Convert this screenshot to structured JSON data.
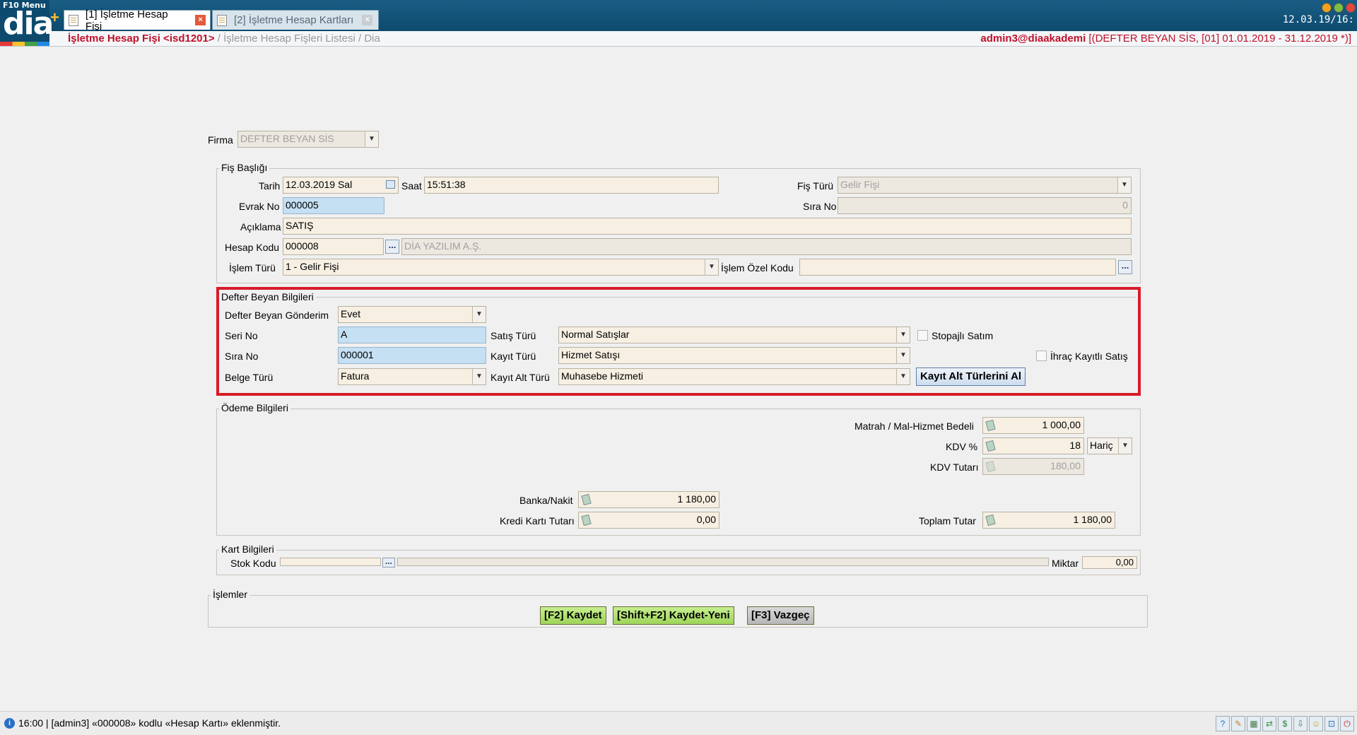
{
  "app": {
    "menu_label": "F10 Menu",
    "logo_text": "dia",
    "add_symbol": "+",
    "clock": "12.03.19/16:"
  },
  "tabs": [
    {
      "label": "[1] İşletme Hesap Fişi",
      "close": "×"
    },
    {
      "label": "[2] İşletme Hesap Kartları",
      "close": "×"
    }
  ],
  "breadcrumb": {
    "current": "İşletme Hesap Fişi <isd1201>",
    "trail": " / İşletme Hesap Fişleri Listesi / Dia"
  },
  "user": {
    "name": "admin3@diaakademi",
    "context": " [(DEFTER BEYAN SİS, [01] 01.01.2019 - 31.12.2019 *)]"
  },
  "firma": {
    "label": "Firma",
    "value": "DEFTER BEYAN SİS"
  },
  "fis_basligi": {
    "title": "Fiş Başlığı",
    "tarih_label": "Tarih",
    "tarih": "12.03.2019 Sal",
    "saat_label": "Saat",
    "saat": "15:51:38",
    "fis_turu_label": "Fiş Türü",
    "fis_turu": "Gelir Fişi",
    "evrak_no_label": "Evrak No",
    "evrak_no": "000005",
    "sira_no_label": "Sıra No",
    "sira_no": "0",
    "aciklama_label": "Açıklama",
    "aciklama": "SATIŞ",
    "hesap_kodu_label": "Hesap Kodu",
    "hesap_kodu": "000008",
    "hesap_adi": "DİA YAZILIM A.Ş.",
    "islem_turu_label": "İşlem Türü",
    "islem_turu": "1 - Gelir Fişi",
    "islem_ozel_kodu_label": "İşlem Özel Kodu",
    "islem_ozel_kodu": "",
    "lookup_btn": "..."
  },
  "defter_beyan": {
    "title": "Defter Beyan Bilgileri",
    "gonderim_label": "Defter Beyan Gönderim",
    "gonderim": "Evet",
    "seri_no_label": "Seri No",
    "seri_no": "A",
    "sira_no_label": "Sıra No",
    "sira_no": "000001",
    "belge_turu_label": "Belge Türü",
    "belge_turu": "Fatura",
    "satis_turu_label": "Satış Türü",
    "satis_turu": "Normal Satışlar",
    "kayit_turu_label": "Kayıt Türü",
    "kayit_turu": "Hizmet Satışı",
    "kayit_alt_turu_label": "Kayıt Alt Türü",
    "kayit_alt_turu": "Muhasebe Hizmeti",
    "stopajli_label": "Stopajlı Satım",
    "stopajli": false,
    "ihrac_label": "İhraç Kayıtlı Satış",
    "ihrac": false,
    "alt_turler_button": "Kayıt Alt Türlerini Al"
  },
  "odeme": {
    "title": "Ödeme Bilgileri",
    "matrah_label": "Matrah / Mal-Hizmet Bedeli",
    "matrah": "1 000,00",
    "kdv_label": "KDV %",
    "kdv": "18",
    "kdv_tip": "Hariç",
    "kdv_tutar_label": "KDV Tutarı",
    "kdv_tutar": "180,00",
    "banka_label": "Banka/Nakit",
    "banka": "1 180,00",
    "kredi_label": "Kredi Kartı Tutarı",
    "kredi": "0,00",
    "toplam_label": "Toplam Tutar",
    "toplam": "1 180,00"
  },
  "kart": {
    "title": "Kart Bilgileri",
    "stok_kodu_label": "Stok Kodu",
    "stok_kodu": "",
    "miktar_label": "Miktar",
    "miktar": "0,00"
  },
  "islemler": {
    "title": "İşlemler",
    "save": "[F2] Kaydet",
    "save_new": "[Shift+F2] Kaydet-Yeni",
    "cancel": "[F3] Vazgeç"
  },
  "status": {
    "message": "16:00 | [admin3] «000008» kodlu «Hesap Kartı» eklenmiştir."
  },
  "colors": {
    "accent_red": "#d81b28",
    "brand_blue": "#0d4a6e",
    "input_bg": "#f6efe2",
    "input_blue": "#c5dff3"
  }
}
